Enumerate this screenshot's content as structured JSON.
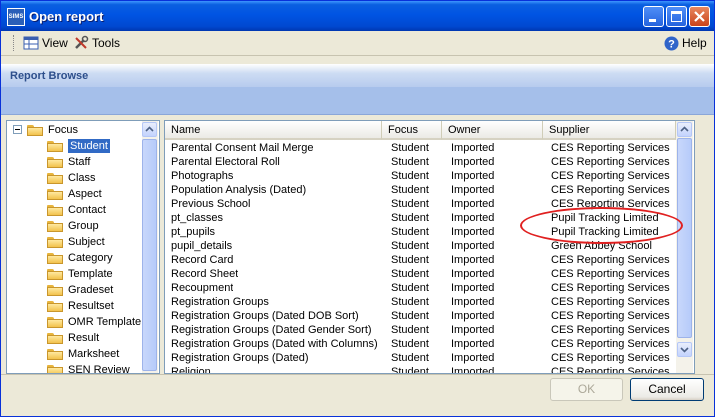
{
  "window": {
    "title": "Open report",
    "app_icon_text": "SIMS"
  },
  "toolbar": {
    "view_label": "View",
    "tools_label": "Tools",
    "help_label": "Help"
  },
  "header": {
    "title": "Report Browse"
  },
  "tree": {
    "root": "Focus",
    "items": [
      "Student",
      "Staff",
      "Class",
      "Aspect",
      "Contact",
      "Group",
      "Subject",
      "Category",
      "Template",
      "Gradeset",
      "Resultset",
      "OMR Template",
      "Result",
      "Marksheet",
      "SEN Review"
    ],
    "selected": "Student"
  },
  "list": {
    "columns": [
      "Name",
      "Focus",
      "Owner",
      "Supplier"
    ],
    "rows": [
      {
        "name": "Parental Consent Mail Merge",
        "focus": "Student",
        "owner": "Imported",
        "supplier": "CES Reporting Services"
      },
      {
        "name": "Parental Electoral Roll",
        "focus": "Student",
        "owner": "Imported",
        "supplier": "CES Reporting Services"
      },
      {
        "name": "Photographs",
        "focus": "Student",
        "owner": "Imported",
        "supplier": "CES Reporting Services"
      },
      {
        "name": "Population Analysis (Dated)",
        "focus": "Student",
        "owner": "Imported",
        "supplier": "CES Reporting Services"
      },
      {
        "name": "Previous School",
        "focus": "Student",
        "owner": "Imported",
        "supplier": "CES Reporting Services"
      },
      {
        "name": "pt_classes",
        "focus": "Student",
        "owner": "Imported",
        "supplier": "Pupil Tracking Limited"
      },
      {
        "name": "pt_pupils",
        "focus": "Student",
        "owner": "Imported",
        "supplier": "Pupil Tracking Limited"
      },
      {
        "name": "pupil_details",
        "focus": "Student",
        "owner": "Imported",
        "supplier": "Green Abbey School"
      },
      {
        "name": "Record Card",
        "focus": "Student",
        "owner": "Imported",
        "supplier": "CES Reporting Services"
      },
      {
        "name": "Record Sheet",
        "focus": "Student",
        "owner": "Imported",
        "supplier": "CES Reporting Services"
      },
      {
        "name": "Recoupment",
        "focus": "Student",
        "owner": "Imported",
        "supplier": "CES Reporting Services"
      },
      {
        "name": "Registration Groups",
        "focus": "Student",
        "owner": "Imported",
        "supplier": "CES Reporting Services"
      },
      {
        "name": "Registration Groups (Dated DOB Sort)",
        "focus": "Student",
        "owner": "Imported",
        "supplier": "CES Reporting Services"
      },
      {
        "name": "Registration Groups (Dated Gender Sort)",
        "focus": "Student",
        "owner": "Imported",
        "supplier": "CES Reporting Services"
      },
      {
        "name": "Registration Groups (Dated with Columns)",
        "focus": "Student",
        "owner": "Imported",
        "supplier": "CES Reporting Services"
      },
      {
        "name": "Registration Groups (Dated)",
        "focus": "Student",
        "owner": "Imported",
        "supplier": "CES Reporting Services"
      },
      {
        "name": "Religion",
        "focus": "Student",
        "owner": "Imported",
        "supplier": "CES Reporting Services"
      }
    ]
  },
  "buttons": {
    "ok": "OK",
    "cancel": "Cancel"
  },
  "colors": {
    "title_bar": "#0054e3",
    "selection": "#316ac5",
    "highlight_ellipse": "#e02020",
    "header_text": "#2d4f8c"
  }
}
